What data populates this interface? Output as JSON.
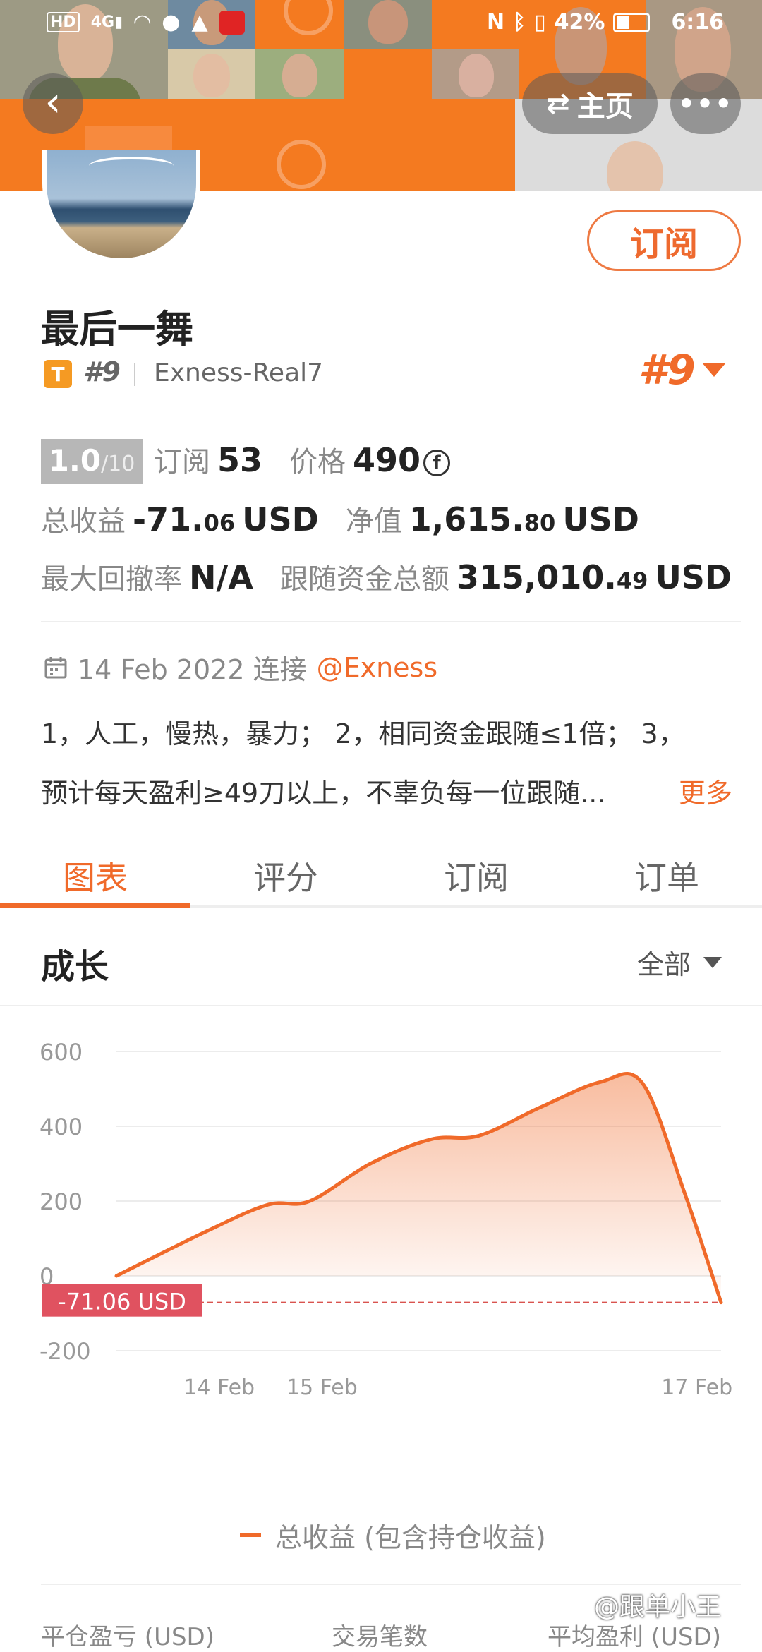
{
  "status_bar": {
    "left_icons": [
      "hd-icon",
      "signal-4g-icon",
      "wifi-icon",
      "wechat-icon",
      "qq-icon",
      "app-icon"
    ],
    "battery": "42%",
    "time": "6:16"
  },
  "nav": {
    "home_label": "主页"
  },
  "profile": {
    "subscribe_label": "订阅",
    "name": "最后一舞",
    "badge": "T",
    "rank_small": "#9",
    "server": "Exness-Real7",
    "rank_big": "#9"
  },
  "stats": {
    "score": "1.0",
    "score_max": "/10",
    "subscribe_label": "订阅",
    "subscribe_count": "53",
    "price_label": "价格",
    "price_value": "490",
    "coin_symbol": "f",
    "total_profit_label": "总收益",
    "total_profit_main": "-71.",
    "total_profit_dec": "06",
    "total_profit_unit": "USD",
    "equity_label": "净值",
    "equity_main": "1,615.",
    "equity_dec": "80",
    "equity_unit": "USD",
    "max_drawdown_label": "最大回撤率",
    "max_drawdown_value": "N/A",
    "follow_funds_label": "跟随资金总额",
    "follow_funds_main": "315,010.",
    "follow_funds_dec": "49",
    "follow_funds_unit": "USD"
  },
  "info": {
    "date": "14 Feb 2022 连接",
    "broker": "@Exness",
    "desc_line1": "1，人工，慢热，暴力； 2，相同资金跟随≤1倍； 3，",
    "desc_line2": "预计每天盈利≥49刀以上，不辜负每一位跟随...",
    "more": "更多"
  },
  "tabs": [
    {
      "label": "图表"
    },
    {
      "label": "评分"
    },
    {
      "label": "订阅"
    },
    {
      "label": "订单"
    }
  ],
  "growth": {
    "title": "成长",
    "filter": "全部"
  },
  "chart_data": {
    "type": "area",
    "ylim": [
      -200,
      600
    ],
    "yticks": [
      "600",
      "400",
      "200",
      "0",
      "-200"
    ],
    "xticks": [
      "14 Feb",
      "15 Feb",
      "17 Feb"
    ],
    "series": [
      {
        "name": "总收益 (包含持仓收益)",
        "points": [
          [
            0,
            0
          ],
          [
            0.15,
            120
          ],
          [
            0.25,
            190
          ],
          [
            0.32,
            200
          ],
          [
            0.42,
            300
          ],
          [
            0.52,
            365
          ],
          [
            0.6,
            375
          ],
          [
            0.7,
            450
          ],
          [
            0.8,
            518
          ],
          [
            0.87,
            515
          ],
          [
            0.94,
            220
          ],
          [
            1.0,
            -71.06
          ]
        ]
      }
    ],
    "current_label": "-71.06 USD",
    "current_value": -71.06,
    "color": "#f06a2a"
  },
  "legend_label": "总收益 (包含持仓收益)",
  "footer": {
    "col1": "平仓盈亏 (USD)",
    "col2": "交易笔数",
    "col3": "平均盈利 (USD)"
  },
  "watermark": "@跟单小王"
}
